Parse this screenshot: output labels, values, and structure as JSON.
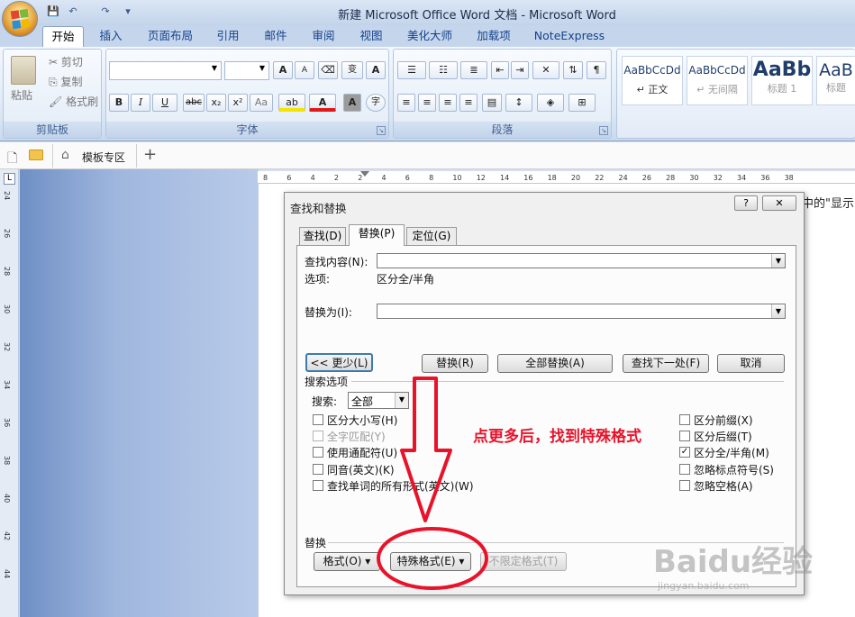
{
  "window": {
    "title": "新建 Microsoft Office Word 文档 - Microsoft Word"
  },
  "qat": {
    "save": "💾",
    "undo": "↶",
    "redo": "↷",
    "more": "▾"
  },
  "ribbon_tabs": [
    "开始",
    "插入",
    "页面布局",
    "引用",
    "邮件",
    "审阅",
    "视图",
    "美化大师",
    "加载项",
    "NoteExpress"
  ],
  "clipboard": {
    "paste": "粘贴",
    "cut": "剪切",
    "copy": "复制",
    "format_painter": "格式刷",
    "group": "剪贴板"
  },
  "font": {
    "group": "字体",
    "grow": "A",
    "shrink": "A",
    "bold": "B",
    "italic": "I",
    "underline": "U",
    "strike": "abc",
    "sub": "x₂",
    "sup": "x²",
    "case": "Aa",
    "highlight": "ab",
    "color": "A",
    "charborder": "A",
    "phonetic": "变",
    "encircle": "字",
    "shade": "A"
  },
  "paragraph": {
    "group": "段落"
  },
  "styles": [
    {
      "sample": "AaBbCcDd",
      "name": "↵ 正文"
    },
    {
      "sample": "AaBbCcDd",
      "name": "↵ 无间隔"
    },
    {
      "sample": "AaBb",
      "name": "标题 1"
    },
    {
      "sample": "AaB",
      "name": "标题"
    }
  ],
  "doc_tabs": {
    "template_zone": "模板专区",
    "add": "+"
  },
  "ruler": {
    "h": [
      "8",
      "6",
      "4",
      "2",
      "2",
      "4",
      "6",
      "8",
      "10",
      "12",
      "14",
      "16",
      "18",
      "20",
      "22",
      "24",
      "26",
      "28",
      "30",
      "32",
      "34",
      "36",
      "38"
    ],
    "v": [
      "24",
      "26",
      "28",
      "30",
      "32",
      "34",
      "36",
      "38",
      "40",
      "42",
      "44"
    ]
  },
  "doc_text": "中的\"显示",
  "dialog": {
    "title": "查找和替换",
    "help": "?",
    "close": "✕",
    "tabs": [
      "查找(D)",
      "替换(P)",
      "定位(G)"
    ],
    "find_label": "查找内容(N):",
    "find_value": "",
    "options_label": "选项:",
    "options_value": "区分全/半角",
    "replace_label": "替换为(I):",
    "replace_value": "",
    "less_btn": "<< 更少(L)",
    "replace_btn": "替换(R)",
    "replace_all_btn": "全部替换(A)",
    "find_next_btn": "查找下一处(F)",
    "cancel_btn": "取消",
    "search_options_title": "搜索选项",
    "search_label": "搜索:",
    "search_value": "全部",
    "left_checks": [
      {
        "label": "区分大小写(H)",
        "checked": false,
        "disabled": false
      },
      {
        "label": "全字匹配(Y)",
        "checked": false,
        "disabled": true
      },
      {
        "label": "使用通配符(U)",
        "checked": false,
        "disabled": false
      },
      {
        "label": "同音(英文)(K)",
        "checked": false,
        "disabled": false
      },
      {
        "label": "查找单词的所有形式(英文)(W)",
        "checked": false,
        "disabled": false
      }
    ],
    "right_checks": [
      {
        "label": "区分前缀(X)",
        "checked": false
      },
      {
        "label": "区分后缀(T)",
        "checked": false
      },
      {
        "label": "区分全/半角(M)",
        "checked": true
      },
      {
        "label": "忽略标点符号(S)",
        "checked": false
      },
      {
        "label": "忽略空格(A)",
        "checked": false
      }
    ],
    "replace_section": "替换",
    "format_btn": "格式(O) ▾",
    "special_btn": "特殊格式(E) ▾",
    "no_format_btn": "不限定格式(T)"
  },
  "annotation": "点更多后，找到特殊格式",
  "watermark": {
    "text": "Baidu经验",
    "url": "jingyan.baidu.com"
  },
  "colors": {
    "annotation": "#e8132a",
    "ribbon_text": "#15428b"
  }
}
